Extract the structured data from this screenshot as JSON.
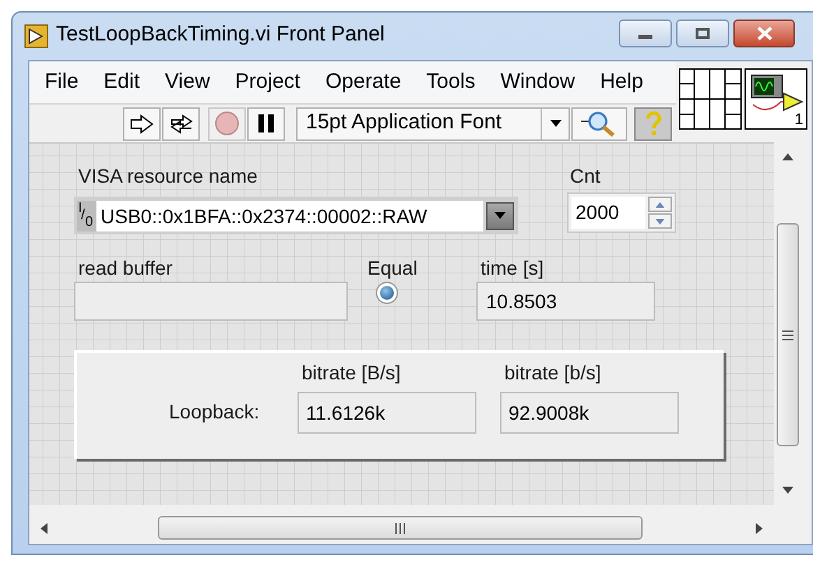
{
  "window": {
    "title": "TestLoopBackTiming.vi Front Panel"
  },
  "menu": [
    "File",
    "Edit",
    "View",
    "Project",
    "Operate",
    "Tools",
    "Window",
    "Help"
  ],
  "toolbar": {
    "font": "15pt Application Font",
    "help_selected": true
  },
  "vi_icon": {
    "number": "1"
  },
  "controls": {
    "visa": {
      "label": "VISA resource name",
      "io": "I/0",
      "value": "USB0::0x1BFA::0x2374::00002::RAW"
    },
    "cnt": {
      "label": "Cnt",
      "value": "2000"
    },
    "read_buffer": {
      "label": "read buffer"
    },
    "equal": {
      "label": "Equal",
      "on": false
    },
    "time": {
      "label": "time [s]",
      "value": "10.8503"
    }
  },
  "loopback": {
    "label": "Loopback:",
    "indicators": [
      {
        "label": "bitrate [B/s]",
        "value": "11.6126k"
      },
      {
        "label": "bitrate [b/s]",
        "value": "92.9008k"
      }
    ]
  }
}
